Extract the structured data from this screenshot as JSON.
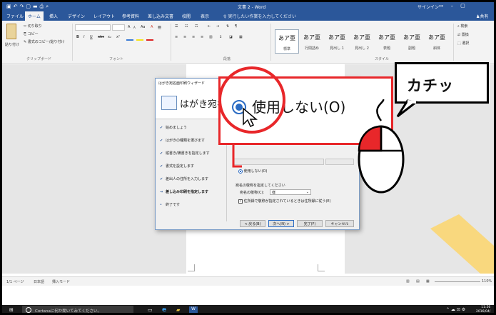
{
  "window": {
    "title": "文書 2 - Word",
    "signin": "サインイン",
    "qat_icons": [
      "save-icon",
      "undo-icon",
      "redo-icon",
      "new-icon",
      "open-icon",
      "print-icon",
      "preview-icon"
    ]
  },
  "tabs": [
    {
      "label": "ファイル"
    },
    {
      "label": "ホーム",
      "active": true
    },
    {
      "label": "挿入"
    },
    {
      "label": "デザイン"
    },
    {
      "label": "レイアウト"
    },
    {
      "label": "参考資料"
    },
    {
      "label": "差し込み文書"
    },
    {
      "label": "校閲"
    },
    {
      "label": "表示"
    }
  ],
  "tellme": "実行したい作業を入力してください",
  "share": "共有",
  "ribbon": {
    "clipboard": {
      "paste": "貼り付け",
      "cut": "切り取り",
      "copy": "コピー",
      "format_painter": "書式のコピー/貼り付け",
      "group": "クリップボード"
    },
    "font": {
      "size_btn_up": "A",
      "size_btn_down": "A",
      "case": "Aa",
      "clear": "A",
      "phonetic": "亜",
      "bold": "B",
      "italic": "I",
      "underline": "U",
      "strike": "abc",
      "sub": "x₂",
      "sup": "x²",
      "group": "フォント"
    },
    "paragraph": {
      "group": "段落"
    },
    "styles": {
      "group": "スタイル",
      "tiles": [
        {
          "big": "あア亜",
          "cap": "標準",
          "selected": true
        },
        {
          "big": "あア亜",
          "cap": "行間詰め"
        },
        {
          "big": "あア亜",
          "cap": "見出し 1"
        },
        {
          "big": "あア亜",
          "cap": "見出し 2"
        },
        {
          "big": "あア亜",
          "cap": "表題"
        },
        {
          "big": "あア亜",
          "cap": "副題"
        },
        {
          "big": "あア亜",
          "cap": "斜体"
        }
      ]
    },
    "editing": {
      "find": "検索",
      "replace": "置換",
      "select": "選択"
    }
  },
  "statusbar": {
    "page": "1/1 ページ",
    "lang": "日本語",
    "mode": "挿入モード",
    "zoom": "110%"
  },
  "taskbar": {
    "search": "Cortanaに何か聞いてみてください。",
    "time": "11:56",
    "date": "2016/04/"
  },
  "wizard": {
    "title": "はがき宛名面印刷ウィザード",
    "header": "はがき宛名面",
    "steps": [
      {
        "mark": "✔",
        "label": "始めましょう"
      },
      {
        "mark": "✔",
        "label": "はがきの種類を選びます"
      },
      {
        "mark": "✔",
        "label": "縦書き/横書きを指定します"
      },
      {
        "mark": "✔",
        "label": "書式を設定します"
      },
      {
        "mark": "✔",
        "label": "差出人の住所を入力します"
      },
      {
        "mark": "→",
        "label": "差し込み印刷を指定します",
        "current": true
      },
      {
        "mark": "•",
        "label": "終了です"
      }
    ],
    "option_none": "使用しない(O)",
    "honorific_heading": "宛名の敬称を指定してください",
    "honorific_label": "宛名の敬称(C):",
    "honorific_value": "様",
    "honorific_check": "住所録で敬称が指定されているときは住所録に従う(E)",
    "buttons": {
      "back": "< 戻る(B)",
      "next": "次へ(N) >",
      "finish": "完了(F)",
      "cancel": "キャンセル"
    }
  },
  "zoom_callout": {
    "label": "使用しない(O)"
  },
  "bubble": {
    "text": "カチッ"
  },
  "colors": {
    "word_blue": "#2b579a",
    "callout_red": "#e8272a",
    "mouse_red": "#e8272a"
  }
}
